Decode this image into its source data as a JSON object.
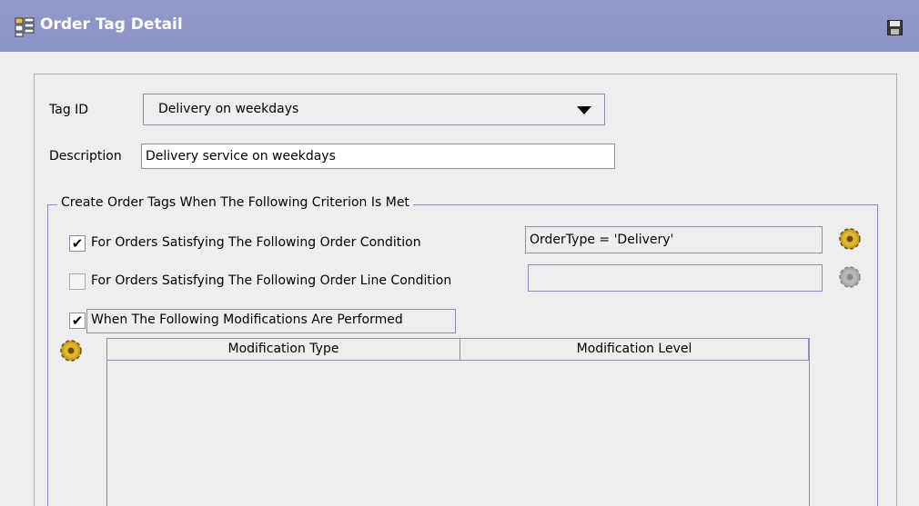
{
  "window": {
    "title": "Order Tag Detail",
    "title_icon": "order-tag-icon",
    "save_icon": "save-icon",
    "title_bar_color": "#8f96c8"
  },
  "form": {
    "tag_id_label": "Tag ID",
    "tag_id_value": "Delivery on weekdays",
    "description_label": "Description",
    "description_value": "Delivery service on weekdays"
  },
  "criteria": {
    "legend": "Create Order Tags When The Following Criterion Is Met",
    "order_condition": {
      "checked": true,
      "check_glyph": "✔",
      "label": "For Orders Satisfying The Following Order Condition",
      "value": "OrderType = 'Delivery'"
    },
    "order_line_condition": {
      "checked": false,
      "check_glyph": "",
      "label": "For Orders Satisfying The Following Order Line Condition",
      "value": ""
    },
    "modifications": {
      "checked": true,
      "check_glyph": "✔",
      "label": "When The Following Modifications Are Performed"
    }
  },
  "table": {
    "columns": [
      "Modification Type",
      "Modification Level"
    ],
    "rows": []
  }
}
